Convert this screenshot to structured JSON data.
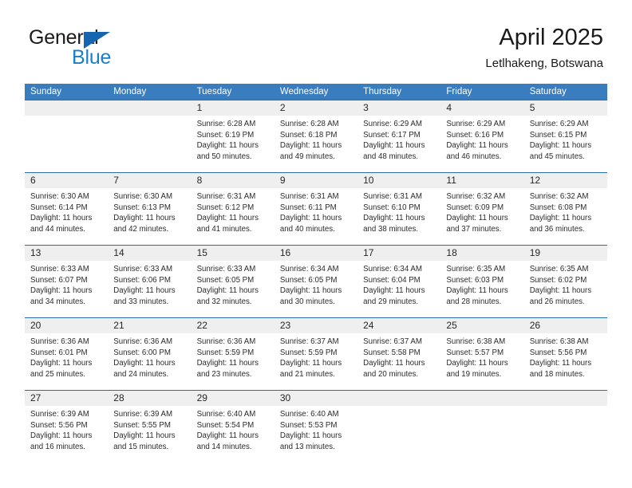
{
  "brand": {
    "word_general": "General",
    "word_blue": "Blue",
    "triangle_color": "#1565b0",
    "blue_text_color": "#1a7ecb"
  },
  "header": {
    "title": "April 2025",
    "subtitle": "Letlhakeng, Botswana",
    "header_bg": "#3a7dbf",
    "row_band_bg": "#efefef",
    "separator_color": "#2a6cb0"
  },
  "weekdays": [
    "Sunday",
    "Monday",
    "Tuesday",
    "Wednesday",
    "Thursday",
    "Friday",
    "Saturday"
  ],
  "weeks": [
    {
      "numbers": [
        "",
        "",
        "1",
        "2",
        "3",
        "4",
        "5"
      ],
      "cells": [
        {
          "sunrise": "",
          "sunset": "",
          "daylight_1": "",
          "daylight_2": ""
        },
        {
          "sunrise": "",
          "sunset": "",
          "daylight_1": "",
          "daylight_2": ""
        },
        {
          "sunrise": "Sunrise: 6:28 AM",
          "sunset": "Sunset: 6:19 PM",
          "daylight_1": "Daylight: 11 hours",
          "daylight_2": "and 50 minutes."
        },
        {
          "sunrise": "Sunrise: 6:28 AM",
          "sunset": "Sunset: 6:18 PM",
          "daylight_1": "Daylight: 11 hours",
          "daylight_2": "and 49 minutes."
        },
        {
          "sunrise": "Sunrise: 6:29 AM",
          "sunset": "Sunset: 6:17 PM",
          "daylight_1": "Daylight: 11 hours",
          "daylight_2": "and 48 minutes."
        },
        {
          "sunrise": "Sunrise: 6:29 AM",
          "sunset": "Sunset: 6:16 PM",
          "daylight_1": "Daylight: 11 hours",
          "daylight_2": "and 46 minutes."
        },
        {
          "sunrise": "Sunrise: 6:29 AM",
          "sunset": "Sunset: 6:15 PM",
          "daylight_1": "Daylight: 11 hours",
          "daylight_2": "and 45 minutes."
        }
      ]
    },
    {
      "numbers": [
        "6",
        "7",
        "8",
        "9",
        "10",
        "11",
        "12"
      ],
      "cells": [
        {
          "sunrise": "Sunrise: 6:30 AM",
          "sunset": "Sunset: 6:14 PM",
          "daylight_1": "Daylight: 11 hours",
          "daylight_2": "and 44 minutes."
        },
        {
          "sunrise": "Sunrise: 6:30 AM",
          "sunset": "Sunset: 6:13 PM",
          "daylight_1": "Daylight: 11 hours",
          "daylight_2": "and 42 minutes."
        },
        {
          "sunrise": "Sunrise: 6:31 AM",
          "sunset": "Sunset: 6:12 PM",
          "daylight_1": "Daylight: 11 hours",
          "daylight_2": "and 41 minutes."
        },
        {
          "sunrise": "Sunrise: 6:31 AM",
          "sunset": "Sunset: 6:11 PM",
          "daylight_1": "Daylight: 11 hours",
          "daylight_2": "and 40 minutes."
        },
        {
          "sunrise": "Sunrise: 6:31 AM",
          "sunset": "Sunset: 6:10 PM",
          "daylight_1": "Daylight: 11 hours",
          "daylight_2": "and 38 minutes."
        },
        {
          "sunrise": "Sunrise: 6:32 AM",
          "sunset": "Sunset: 6:09 PM",
          "daylight_1": "Daylight: 11 hours",
          "daylight_2": "and 37 minutes."
        },
        {
          "sunrise": "Sunrise: 6:32 AM",
          "sunset": "Sunset: 6:08 PM",
          "daylight_1": "Daylight: 11 hours",
          "daylight_2": "and 36 minutes."
        }
      ]
    },
    {
      "numbers": [
        "13",
        "14",
        "15",
        "16",
        "17",
        "18",
        "19"
      ],
      "cells": [
        {
          "sunrise": "Sunrise: 6:33 AM",
          "sunset": "Sunset: 6:07 PM",
          "daylight_1": "Daylight: 11 hours",
          "daylight_2": "and 34 minutes."
        },
        {
          "sunrise": "Sunrise: 6:33 AM",
          "sunset": "Sunset: 6:06 PM",
          "daylight_1": "Daylight: 11 hours",
          "daylight_2": "and 33 minutes."
        },
        {
          "sunrise": "Sunrise: 6:33 AM",
          "sunset": "Sunset: 6:05 PM",
          "daylight_1": "Daylight: 11 hours",
          "daylight_2": "and 32 minutes."
        },
        {
          "sunrise": "Sunrise: 6:34 AM",
          "sunset": "Sunset: 6:05 PM",
          "daylight_1": "Daylight: 11 hours",
          "daylight_2": "and 30 minutes."
        },
        {
          "sunrise": "Sunrise: 6:34 AM",
          "sunset": "Sunset: 6:04 PM",
          "daylight_1": "Daylight: 11 hours",
          "daylight_2": "and 29 minutes."
        },
        {
          "sunrise": "Sunrise: 6:35 AM",
          "sunset": "Sunset: 6:03 PM",
          "daylight_1": "Daylight: 11 hours",
          "daylight_2": "and 28 minutes."
        },
        {
          "sunrise": "Sunrise: 6:35 AM",
          "sunset": "Sunset: 6:02 PM",
          "daylight_1": "Daylight: 11 hours",
          "daylight_2": "and 26 minutes."
        }
      ]
    },
    {
      "numbers": [
        "20",
        "21",
        "22",
        "23",
        "24",
        "25",
        "26"
      ],
      "cells": [
        {
          "sunrise": "Sunrise: 6:36 AM",
          "sunset": "Sunset: 6:01 PM",
          "daylight_1": "Daylight: 11 hours",
          "daylight_2": "and 25 minutes."
        },
        {
          "sunrise": "Sunrise: 6:36 AM",
          "sunset": "Sunset: 6:00 PM",
          "daylight_1": "Daylight: 11 hours",
          "daylight_2": "and 24 minutes."
        },
        {
          "sunrise": "Sunrise: 6:36 AM",
          "sunset": "Sunset: 5:59 PM",
          "daylight_1": "Daylight: 11 hours",
          "daylight_2": "and 23 minutes."
        },
        {
          "sunrise": "Sunrise: 6:37 AM",
          "sunset": "Sunset: 5:59 PM",
          "daylight_1": "Daylight: 11 hours",
          "daylight_2": "and 21 minutes."
        },
        {
          "sunrise": "Sunrise: 6:37 AM",
          "sunset": "Sunset: 5:58 PM",
          "daylight_1": "Daylight: 11 hours",
          "daylight_2": "and 20 minutes."
        },
        {
          "sunrise": "Sunrise: 6:38 AM",
          "sunset": "Sunset: 5:57 PM",
          "daylight_1": "Daylight: 11 hours",
          "daylight_2": "and 19 minutes."
        },
        {
          "sunrise": "Sunrise: 6:38 AM",
          "sunset": "Sunset: 5:56 PM",
          "daylight_1": "Daylight: 11 hours",
          "daylight_2": "and 18 minutes."
        }
      ]
    },
    {
      "numbers": [
        "27",
        "28",
        "29",
        "30",
        "",
        "",
        ""
      ],
      "cells": [
        {
          "sunrise": "Sunrise: 6:39 AM",
          "sunset": "Sunset: 5:56 PM",
          "daylight_1": "Daylight: 11 hours",
          "daylight_2": "and 16 minutes."
        },
        {
          "sunrise": "Sunrise: 6:39 AM",
          "sunset": "Sunset: 5:55 PM",
          "daylight_1": "Daylight: 11 hours",
          "daylight_2": "and 15 minutes."
        },
        {
          "sunrise": "Sunrise: 6:40 AM",
          "sunset": "Sunset: 5:54 PM",
          "daylight_1": "Daylight: 11 hours",
          "daylight_2": "and 14 minutes."
        },
        {
          "sunrise": "Sunrise: 6:40 AM",
          "sunset": "Sunset: 5:53 PM",
          "daylight_1": "Daylight: 11 hours",
          "daylight_2": "and 13 minutes."
        },
        {
          "sunrise": "",
          "sunset": "",
          "daylight_1": "",
          "daylight_2": ""
        },
        {
          "sunrise": "",
          "sunset": "",
          "daylight_1": "",
          "daylight_2": ""
        },
        {
          "sunrise": "",
          "sunset": "",
          "daylight_1": "",
          "daylight_2": ""
        }
      ]
    }
  ]
}
